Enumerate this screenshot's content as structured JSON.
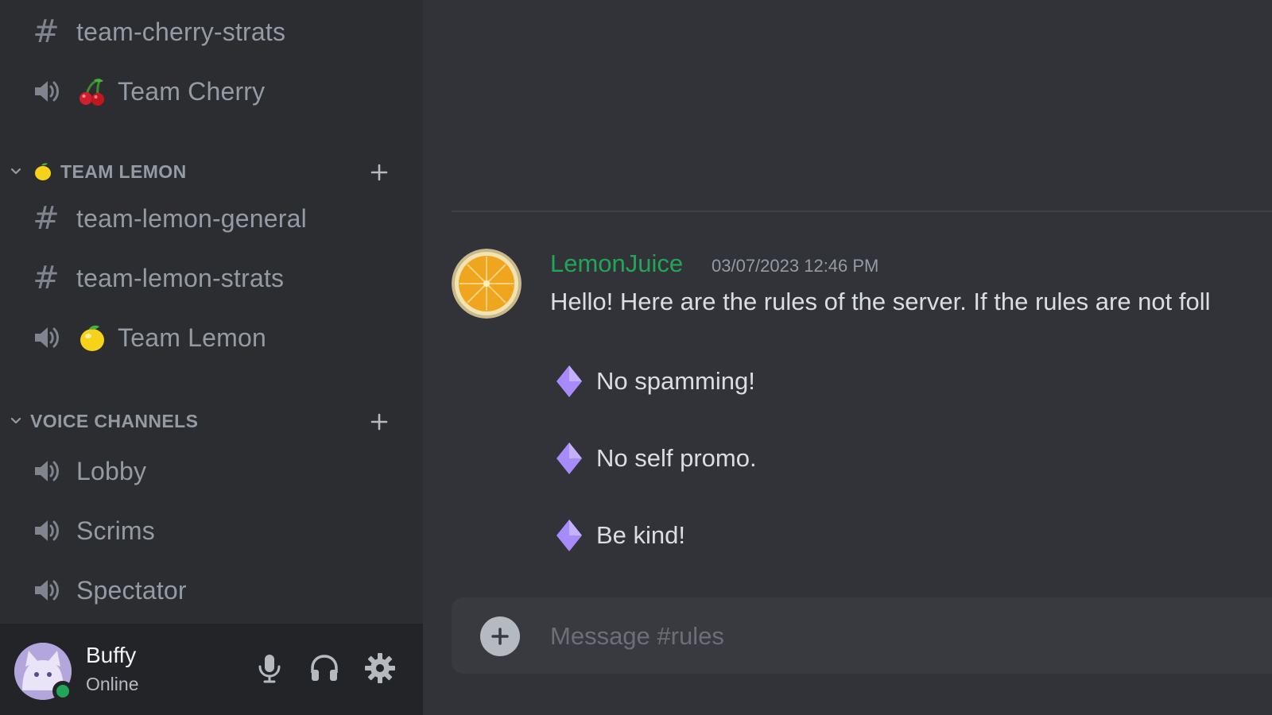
{
  "sidebar": {
    "channels_top": [
      {
        "type": "text",
        "name": "team-cherry-strats"
      },
      {
        "type": "voice",
        "emoji": "cherries",
        "name": "Team Cherry"
      }
    ],
    "categories": [
      {
        "label": "TEAM LEMON",
        "emoji": "lemon",
        "channels": [
          {
            "type": "text",
            "name": "team-lemon-general"
          },
          {
            "type": "text",
            "name": "team-lemon-strats"
          },
          {
            "type": "voice",
            "emoji": "lemon",
            "name": "Team Lemon"
          }
        ]
      },
      {
        "label": "VOICE CHANNELS",
        "channels": [
          {
            "type": "voice",
            "name": "Lobby"
          },
          {
            "type": "voice",
            "name": "Scrims"
          },
          {
            "type": "voice",
            "name": "Spectator"
          }
        ]
      }
    ]
  },
  "user": {
    "name": "Buffy",
    "status": "Online",
    "status_color": "#23a559",
    "controls": [
      "microphone-icon",
      "headphones-icon",
      "settings-gear-icon"
    ]
  },
  "message": {
    "author": "LemonJuice",
    "author_color": "#23a559",
    "timestamp": "03/07/2023 12:46 PM",
    "text": "Hello! Here are the rules of the server. If the rules are not foll",
    "rules": [
      "No spamming!",
      "No self promo.",
      "Be kind!"
    ],
    "bullet_color": "#a78bfa"
  },
  "composer": {
    "placeholder": "Message #rules"
  }
}
